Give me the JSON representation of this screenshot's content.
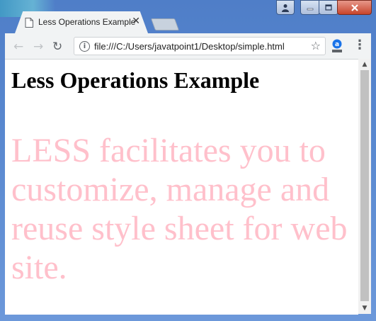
{
  "tab": {
    "title": "Less Operations Example",
    "close_glyph": "✕",
    "favicon": "page-icon"
  },
  "window_controls": {
    "user_icon": "user-icon",
    "minimize_icon": "minimize-icon",
    "maximize_icon": "maximize-icon",
    "close_icon": "close-icon"
  },
  "toolbar": {
    "back_glyph": "←",
    "forward_glyph": "→",
    "reload_glyph": "↻",
    "url": "file:///C:/Users/javatpoint1/Desktop/simple.html",
    "info_glyph": "i",
    "star_glyph": "☆",
    "menu_glyph": "⋮",
    "extension_icon": "extension-icon"
  },
  "page": {
    "heading": "Less Operations Example",
    "paragraph": "LESS facilitates you to customize, manage and reuse style sheet for web site.",
    "paragraph_color": "#ffc0cb"
  },
  "scrollbar": {
    "up_glyph": "▲",
    "down_glyph": "▼"
  },
  "colors": {
    "frame": "#5a89d0",
    "toolbar_bg": "#f1f3f4"
  }
}
